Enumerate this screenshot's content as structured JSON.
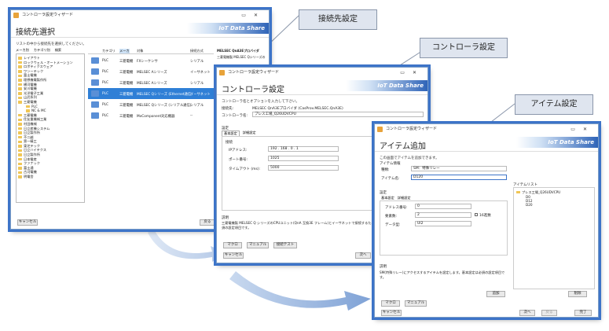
{
  "callouts": {
    "connection": "接続先設定",
    "controller": "コントローラ設定",
    "item": "アイテム設定"
  },
  "banner": "IoT Data Share",
  "wizard_title": "コントローラ設定ウィザード",
  "win1": {
    "title": "接続先選択",
    "description": "リストの中から接続先を選択してください。",
    "tabs": [
      "メーカ別",
      "カテゴリ別",
      "検索"
    ],
    "columns": [
      "カテゴリ",
      "メーカ",
      "対象",
      "接続方式"
    ],
    "tree": [
      "レイアウト",
      "ロックウェル・オートメーション",
      "ロボティクスウェア",
      "ワンーテック",
      "富士電機",
      "理想機電製作所",
      "横河電機",
      "安川電機",
      "光洋電子工業",
      "山武系列",
      "三菱電機",
      "PLC",
      "NC & MC",
      "三菱電機",
      "住友重機械工業",
      "村田機械",
      "日立産機システム",
      "日立製作所",
      "不二越",
      "第一精工",
      "東芝テック",
      "日立ハイテクス",
      "日立製作所",
      "日本電産",
      "ファナック",
      "富士通",
      "古河電機",
      "明電舎"
    ],
    "rows": [
      {
        "cat": "PLC",
        "maker": "三菱電機",
        "target": "FXシーケンサ",
        "method": "シリアル"
      },
      {
        "cat": "PLC",
        "maker": "三菱電機",
        "target": "MELSEC Aシリーズ",
        "method": "イーサネット"
      },
      {
        "cat": "PLC",
        "maker": "三菱電機",
        "target": "MELSEC Aシリーズ",
        "method": "シリアル"
      },
      {
        "cat": "PLC",
        "maker": "三菱電機",
        "target": "MELSEC Qシリーズ (Ethernet通信)",
        "method": "イーサネット"
      },
      {
        "cat": "PLC",
        "maker": "三菱電機",
        "target": "MELSEC Qシリーズ (シリアル通信)",
        "method": "シリアル"
      },
      {
        "cat": "PLC",
        "maker": "三菱電機",
        "target": "MxComponent対応機器",
        "method": "--"
      }
    ],
    "prop_title": "MELSEC QnA3Eプロバイダ",
    "prop_text": "三菱電機製 MELSEC Qシリーズの",
    "cancel": "キャンセル",
    "back": "戻る"
  },
  "win2": {
    "title": "コントローラ設定",
    "description": "コントローラ名とオプションを入力して下さい。",
    "connection_label": "接続先:",
    "connection_value": "MELSEC QnA3Eプロバイダ (CasProv.MELSEC.QnA3E)",
    "controller_label": "コントローラ名:",
    "controller_value": "プレス工場_Q26UDVCPU",
    "settings_label": "設定",
    "tabs": [
      "基本設定",
      "詳細設定"
    ],
    "connect_label": "接続",
    "ip_label": "IPアドレス:",
    "ip_value": "192 . 168 . 0 . 1",
    "port_label": "ポート番号:",
    "port_value": "1025",
    "timeout_label": "タイムアウト (ms):",
    "timeout_value": "5000",
    "help_label": "説明",
    "help_text": "三菱電機製 MELSEC Q シリーズのCPUユニット(QnA 互換3E フレーム)とイーサネットで接続するための設定を行います。基本設定は必須の設定項目です。",
    "macro": "マクロ",
    "manual": "マニュアル",
    "test": "接続テスト",
    "cancel": "キャンセル",
    "next": "次へ"
  },
  "win3": {
    "title": "アイテム追加",
    "description": "この画面でアイテムを追加できます。",
    "item_info": "アイテム情報",
    "type_label": "種類:",
    "type_value": "SM：特殊リレー",
    "name_label": "アイテム名:",
    "name_value": "D120",
    "settings_label": "設定",
    "tabs": [
      "基本設定",
      "詳細設定"
    ],
    "addr_label": "アドレス番号:",
    "addr_value": "0",
    "count_label": "要素数:",
    "count_value": "2",
    "hex_label": "16進数",
    "datatype_label": "データ型:",
    "datatype_value": "UI2",
    "help_label": "説明",
    "help_text": "SM(特殊リレー)にアクセスするアイテムを設定します。基本設定は必須の設定項目です。",
    "add": "追加",
    "list_label": "アイテムリスト",
    "tree_root": "プレス工場_Q26UDVCPU",
    "tree_items": [
      "D0",
      "D12",
      "D20"
    ],
    "delete": "削除",
    "macro": "マクロ",
    "manual": "マニュアル",
    "cancel": "キャンセル",
    "next": "次へ",
    "back": "戻る",
    "finish": "完了"
  }
}
